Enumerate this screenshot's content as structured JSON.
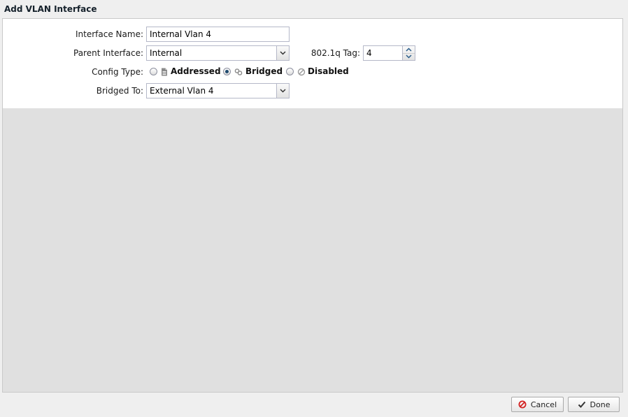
{
  "window": {
    "title": "Add VLAN Interface"
  },
  "form": {
    "interface_name": {
      "label": "Interface Name:",
      "value": "Internal Vlan 4"
    },
    "parent_interface": {
      "label": "Parent Interface:",
      "value": "Internal"
    },
    "vlan_tag": {
      "label": "802.1q Tag:",
      "value": "4"
    },
    "config_type": {
      "label": "Config Type:",
      "options": [
        {
          "label": "Addressed",
          "icon": "document-icon",
          "selected": false
        },
        {
          "label": "Bridged",
          "icon": "link-icon",
          "selected": true
        },
        {
          "label": "Disabled",
          "icon": "disabled-icon",
          "selected": false
        }
      ]
    },
    "bridged_to": {
      "label": "Bridged To:",
      "value": "External Vlan 4"
    }
  },
  "footer": {
    "cancel_label": "Cancel",
    "done_label": "Done"
  },
  "colors": {
    "cancel_icon": "#d32020",
    "done_icon": "#333333",
    "radio_selected": "#1f4a6e"
  }
}
